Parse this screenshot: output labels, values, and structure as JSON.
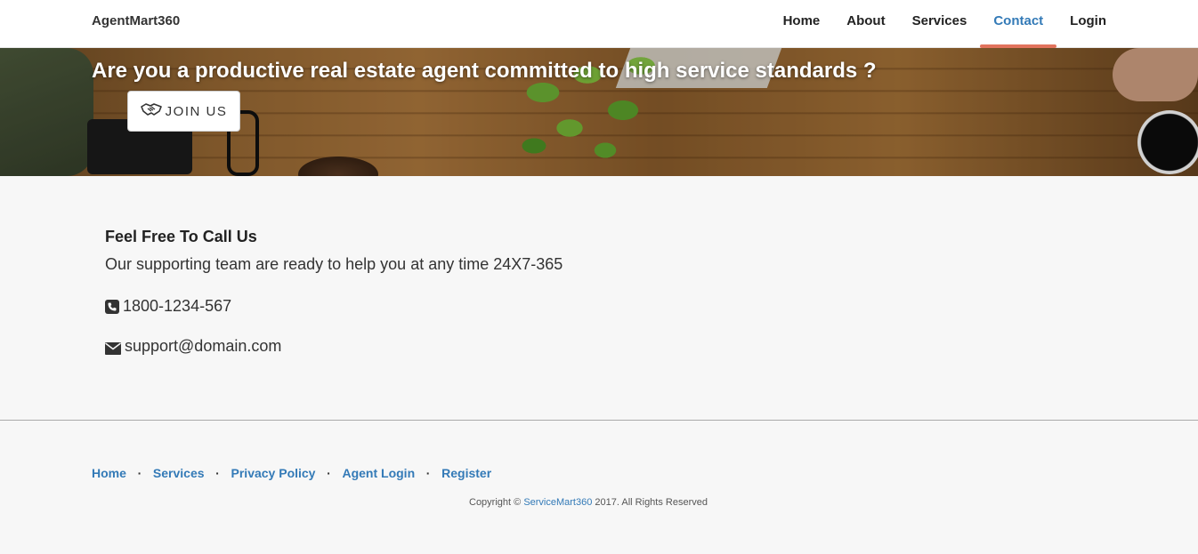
{
  "navbar": {
    "brand": "AgentMart360",
    "items": [
      {
        "label": "Home",
        "active": false
      },
      {
        "label": "About",
        "active": false
      },
      {
        "label": "Services",
        "active": false
      },
      {
        "label": "Contact",
        "active": true
      },
      {
        "label": "Login",
        "active": false
      }
    ],
    "active_underline_color": "#e2735d",
    "active_text_color": "#337ab7"
  },
  "hero": {
    "title": "Are you a productive real estate agent committed to high service standards ?",
    "join_button": {
      "label": "JOIN US",
      "icon": "handshake-icon"
    }
  },
  "contact": {
    "heading": "Feel Free To Call Us",
    "tagline": "Our supporting team are ready to help you at any time 24X7-365",
    "phone": {
      "icon": "phone-icon",
      "value": "1800-1234-567"
    },
    "email": {
      "icon": "envelope-icon",
      "value": "support@domain.com"
    }
  },
  "footer": {
    "links": [
      {
        "label": "Home"
      },
      {
        "label": "Services"
      },
      {
        "label": "Privacy Policy"
      },
      {
        "label": "Agent Login"
      },
      {
        "label": "Register"
      }
    ],
    "separator": "·",
    "link_color": "#337ab7",
    "copyright": {
      "prefix": "Copyright ©",
      "brand": "ServiceMart360",
      "suffix": "2017. All Rights Reserved"
    }
  }
}
